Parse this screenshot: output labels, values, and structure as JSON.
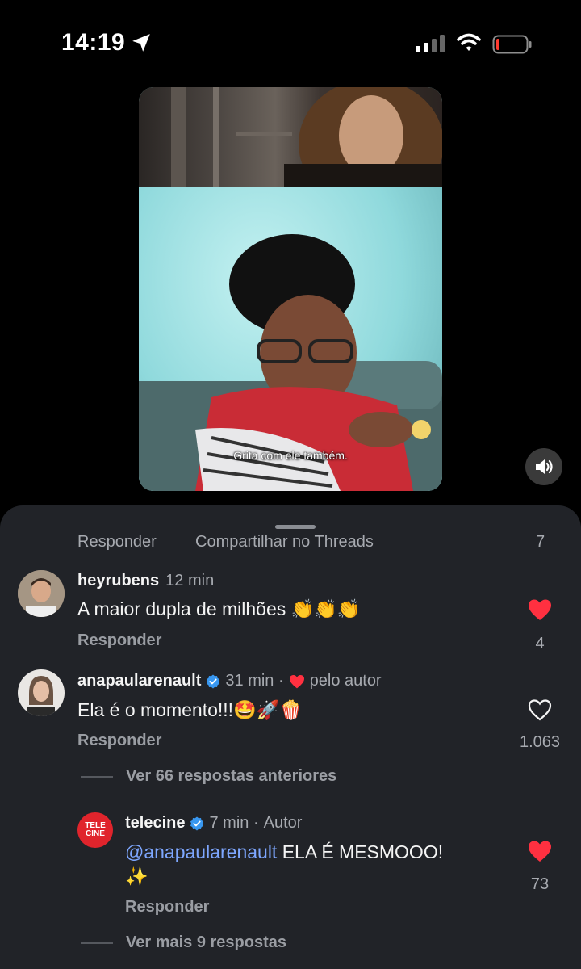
{
  "status_bar": {
    "time": "14:19"
  },
  "video": {
    "caption": "Grita com ele também."
  },
  "cut_row": {
    "reply": "Responder",
    "share": "Compartilhar no Threads",
    "count": "7"
  },
  "comments": [
    {
      "username": "heyrubens",
      "time": "12 min",
      "text": "A maior dupla de milhões 👏👏👏",
      "reply_label": "Responder",
      "likes": "4",
      "liked": true
    },
    {
      "username": "anapaularenault",
      "verified": true,
      "time": "31 min ·",
      "author_like": "pelo autor",
      "text": "Ela é o momento!!!🤩🚀🍿",
      "reply_label": "Responder",
      "likes": "1.063",
      "liked": false,
      "view_previous": "Ver 66 respostas anteriores"
    },
    {
      "username": "telecine",
      "verified": true,
      "time": "7 min ·",
      "author_tag": "Autor",
      "avatar_text_1": "TELE",
      "avatar_text_2": "CINE",
      "mention": "@anapaularenault",
      "text": "ELA É MESMOOO!",
      "text_line2": "✨",
      "reply_label": "Responder",
      "likes": "73",
      "liked": true,
      "view_more": "Ver mais 9 respostas"
    }
  ],
  "colors": {
    "like_red": "#ff3040",
    "sheet_bg": "#212328",
    "mention_blue": "#7ea7ff"
  }
}
